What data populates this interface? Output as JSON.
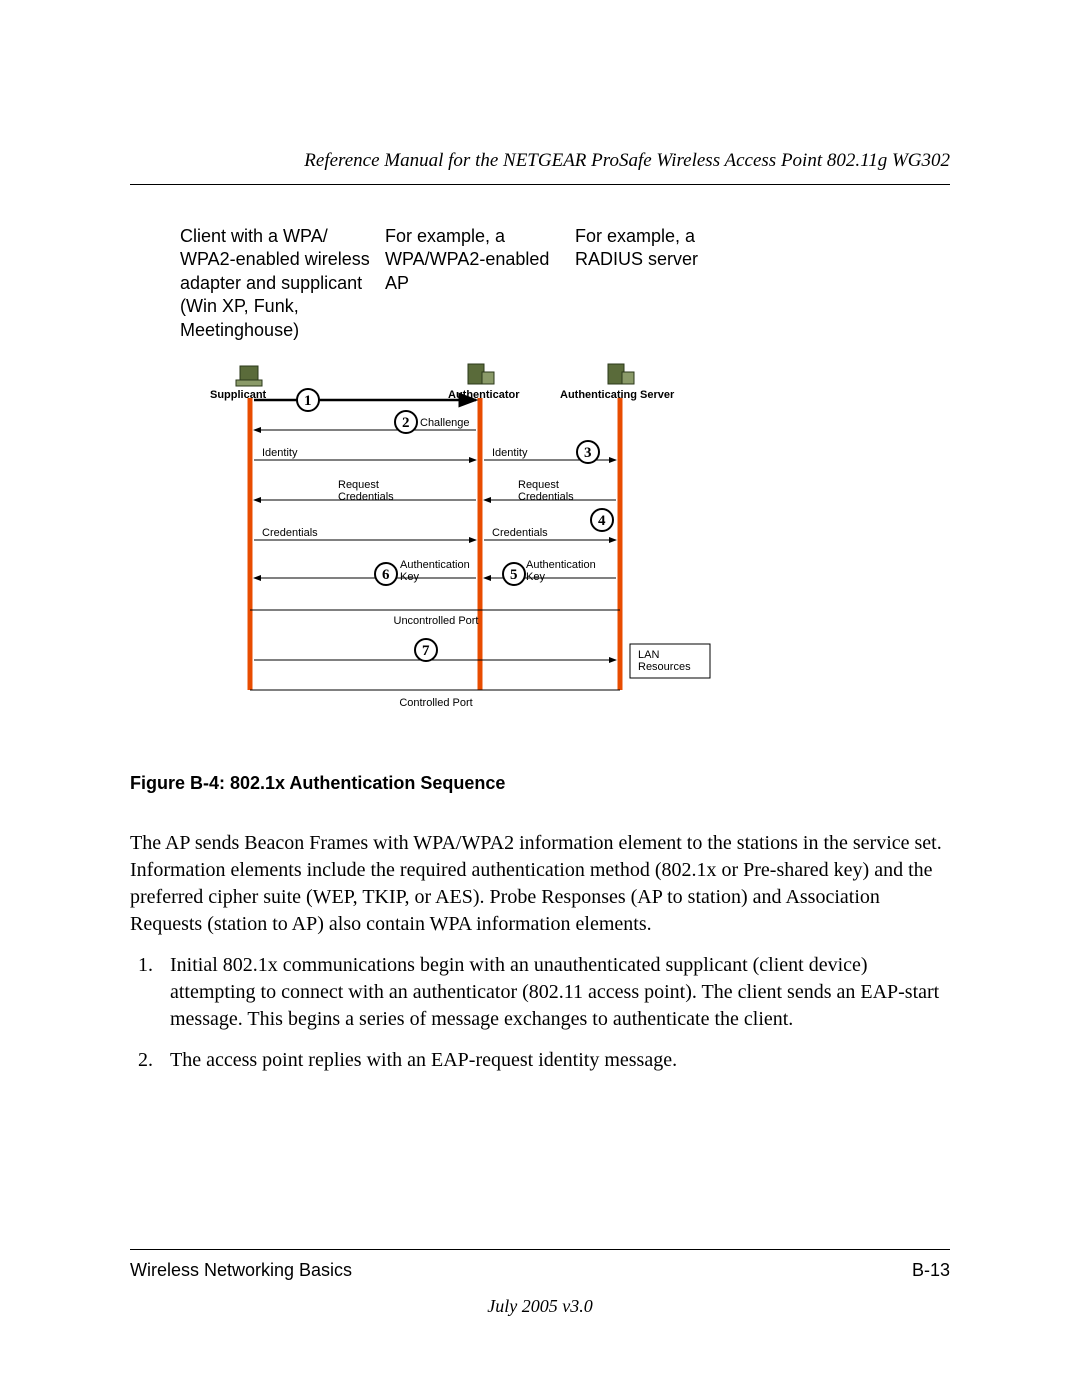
{
  "header": {
    "title": "Reference Manual for the NETGEAR ProSafe Wireless Access Point 802.11g WG302"
  },
  "labels": {
    "client": "Client with a WPA/\nWPA2-enabled wireless adapter and supplicant (Win XP, Funk, Meetinghouse)",
    "ap": "For example, a WPA/WPA2-enabled AP",
    "server": "For example, a RADIUS server"
  },
  "diagram": {
    "nodes": {
      "supplicant": "Supplicant",
      "authenticator": "Authenticator",
      "auth_server": "Authenticating Server"
    },
    "steps": {
      "s1": "1",
      "s2": "2",
      "s3": "3",
      "s4": "4",
      "s5": "5",
      "s6": "6",
      "s7": "7"
    },
    "msgs": {
      "challenge": "Challenge",
      "identity_l": "Identity",
      "identity_r": "Identity",
      "req_l": "Request\nCredentials",
      "req_r": "Request\nCredentials",
      "cred_l": "Credentials",
      "cred_r": "Credentials",
      "auth_l": "Authentication\nKey",
      "auth_r": "Authentication\nKey",
      "uncontrolled": "Uncontrolled Port",
      "controlled": "Controlled Port",
      "lan": "LAN\nResources"
    }
  },
  "figure_caption": "Figure B-4:  802.1x Authentication Sequence",
  "body_para": "The AP sends Beacon Frames with WPA/WPA2 information element to the stations in the service set. Information elements include the required authentication method (802.1x or Pre-shared key) and the preferred cipher suite (WEP, TKIP, or AES). Probe Responses (AP to station) and Association Requests (station to AP) also contain WPA information elements.",
  "list": {
    "item1": "Initial 802.1x communications begin with an unauthenticated supplicant (client device) attempting to connect with an authenticator (802.11 access point). The client sends an EAP-start message. This begins a series of message exchanges to authenticate the client.",
    "item2": "The access point replies with an EAP-request identity message."
  },
  "footer": {
    "section": "Wireless Networking Basics",
    "page": "B-13",
    "date": "July 2005 v3.0"
  }
}
